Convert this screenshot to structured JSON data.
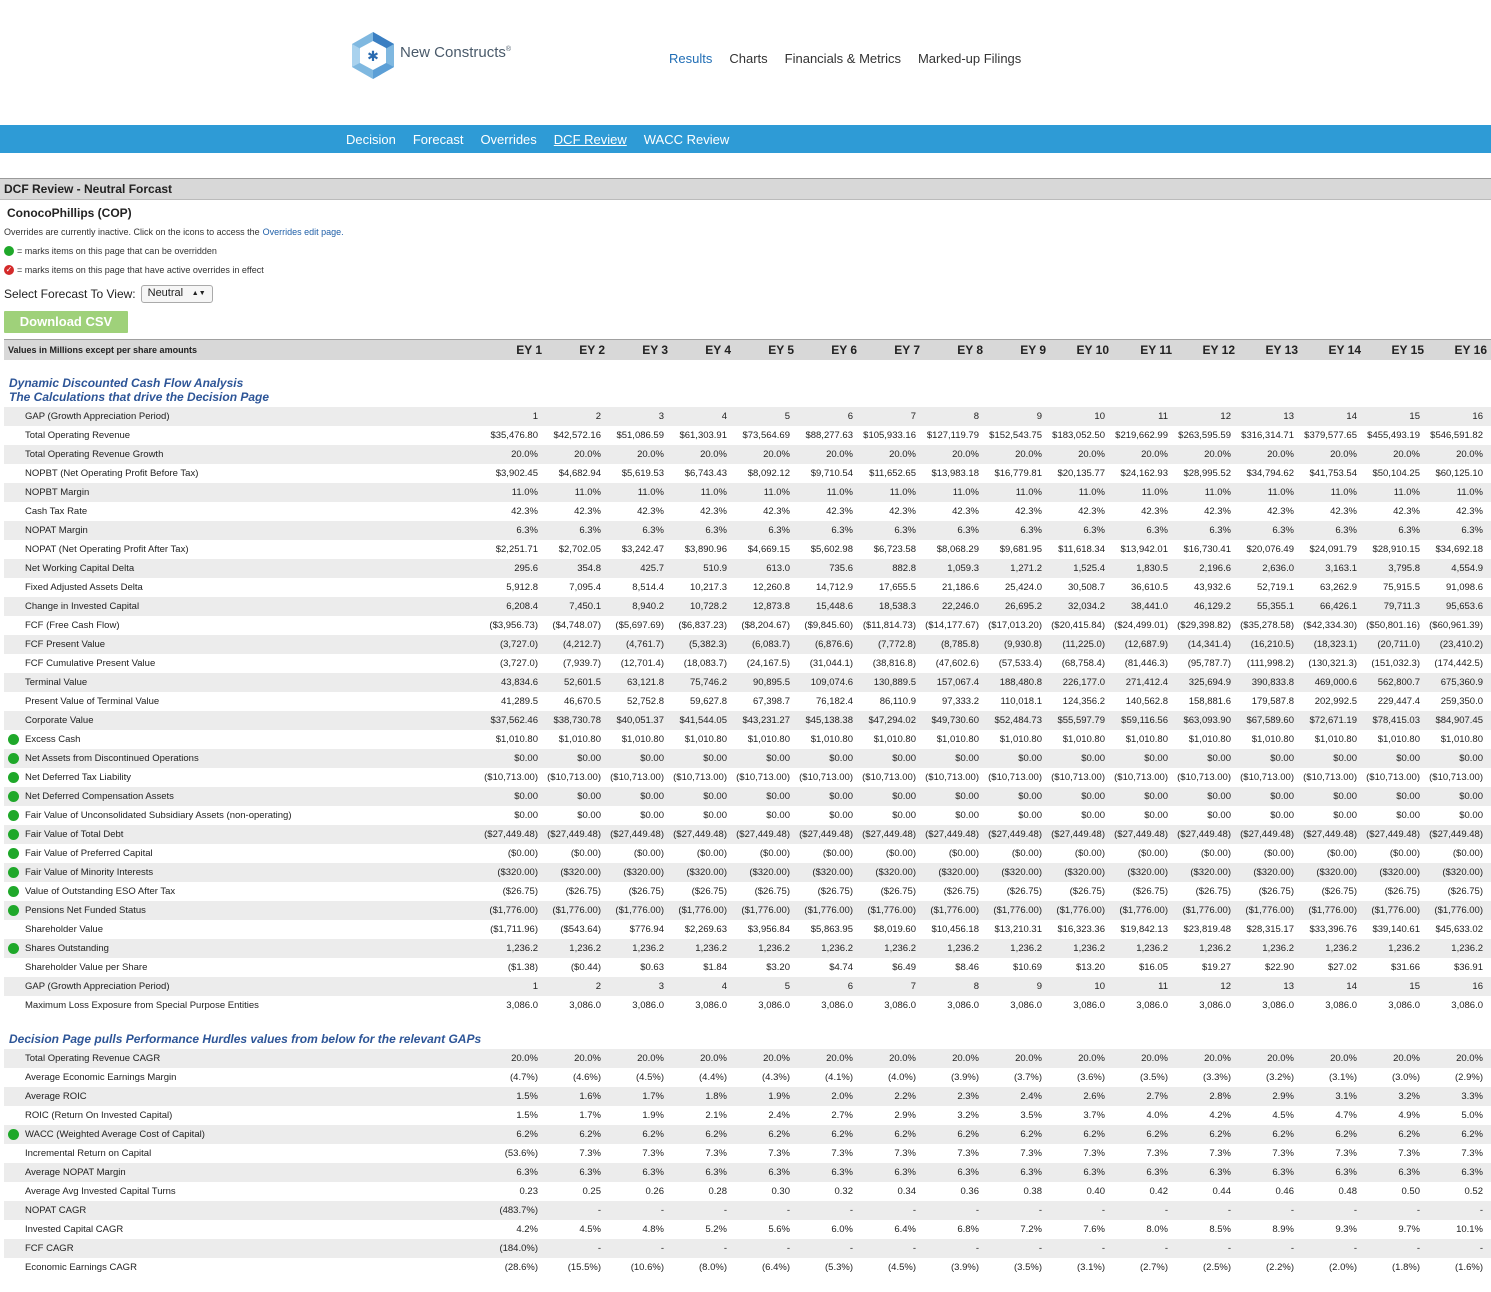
{
  "brand": {
    "name": "New Constructs",
    "mark": "®"
  },
  "top_nav": [
    {
      "label": "Results",
      "active": true
    },
    {
      "label": "Charts",
      "active": false
    },
    {
      "label": "Financials & Metrics",
      "active": false
    },
    {
      "label": "Marked-up Filings",
      "active": false
    }
  ],
  "sub_nav": [
    {
      "label": "Decision",
      "active": false
    },
    {
      "label": "Forecast",
      "active": false
    },
    {
      "label": "Overrides",
      "active": false
    },
    {
      "label": "DCF Review",
      "active": true
    },
    {
      "label": "WACC Review",
      "active": false
    }
  ],
  "section_title": "DCF Review - Neutral Forcast",
  "company": "ConocoPhillips (COP)",
  "notes": {
    "inactive": "Overrides are currently inactive. Click on the icons to access the",
    "inactive_link": "Overrides edit page.",
    "can_override": "= marks items on this page that can be overridden",
    "active_override": "= marks items on this page that have active overrides in effect"
  },
  "forecast_select": {
    "label": "Select Forecast To View:",
    "value": "Neutral"
  },
  "download_label": "Download CSV",
  "table_header": {
    "label": "Values in Millions except per share amounts",
    "columns": [
      "EY 1",
      "EY 2",
      "EY 3",
      "EY 4",
      "EY 5",
      "EY 6",
      "EY 7",
      "EY 8",
      "EY 9",
      "EY 10",
      "EY 11",
      "EY 12",
      "EY 13",
      "EY 14",
      "EY 15",
      "EY 16"
    ]
  },
  "heading1": [
    "Dynamic Discounted Cash Flow Analysis",
    "The Calculations that drive the Decision Page"
  ],
  "heading2": "Decision Page pulls Performance Hurdles values from below for the relevant GAPs",
  "dcf_rows": [
    {
      "name": "GAP (Growth Appreciation Period)",
      "dot": false,
      "values": [
        "1",
        "2",
        "3",
        "4",
        "5",
        "6",
        "7",
        "8",
        "9",
        "10",
        "11",
        "12",
        "13",
        "14",
        "15",
        "16"
      ]
    },
    {
      "name": "Total Operating Revenue",
      "dot": false,
      "values": [
        "$35,476.80",
        "$42,572.16",
        "$51,086.59",
        "$61,303.91",
        "$73,564.69",
        "$88,277.63",
        "$105,933.16",
        "$127,119.79",
        "$152,543.75",
        "$183,052.50",
        "$219,662.99",
        "$263,595.59",
        "$316,314.71",
        "$379,577.65",
        "$455,493.19",
        "$546,591.82"
      ]
    },
    {
      "name": "Total Operating Revenue Growth",
      "dot": false,
      "values": [
        "20.0%",
        "20.0%",
        "20.0%",
        "20.0%",
        "20.0%",
        "20.0%",
        "20.0%",
        "20.0%",
        "20.0%",
        "20.0%",
        "20.0%",
        "20.0%",
        "20.0%",
        "20.0%",
        "20.0%",
        "20.0%"
      ]
    },
    {
      "name": "NOPBT (Net Operating Profit Before Tax)",
      "dot": false,
      "values": [
        "$3,902.45",
        "$4,682.94",
        "$5,619.53",
        "$6,743.43",
        "$8,092.12",
        "$9,710.54",
        "$11,652.65",
        "$13,983.18",
        "$16,779.81",
        "$20,135.77",
        "$24,162.93",
        "$28,995.52",
        "$34,794.62",
        "$41,753.54",
        "$50,104.25",
        "$60,125.10"
      ]
    },
    {
      "name": "NOPBT Margin",
      "dot": false,
      "values": [
        "11.0%",
        "11.0%",
        "11.0%",
        "11.0%",
        "11.0%",
        "11.0%",
        "11.0%",
        "11.0%",
        "11.0%",
        "11.0%",
        "11.0%",
        "11.0%",
        "11.0%",
        "11.0%",
        "11.0%",
        "11.0%"
      ]
    },
    {
      "name": "Cash Tax Rate",
      "dot": false,
      "values": [
        "42.3%",
        "42.3%",
        "42.3%",
        "42.3%",
        "42.3%",
        "42.3%",
        "42.3%",
        "42.3%",
        "42.3%",
        "42.3%",
        "42.3%",
        "42.3%",
        "42.3%",
        "42.3%",
        "42.3%",
        "42.3%"
      ]
    },
    {
      "name": "NOPAT Margin",
      "dot": false,
      "values": [
        "6.3%",
        "6.3%",
        "6.3%",
        "6.3%",
        "6.3%",
        "6.3%",
        "6.3%",
        "6.3%",
        "6.3%",
        "6.3%",
        "6.3%",
        "6.3%",
        "6.3%",
        "6.3%",
        "6.3%",
        "6.3%"
      ]
    },
    {
      "name": "NOPAT (Net Operating Profit After Tax)",
      "dot": false,
      "values": [
        "$2,251.71",
        "$2,702.05",
        "$3,242.47",
        "$3,890.96",
        "$4,669.15",
        "$5,602.98",
        "$6,723.58",
        "$8,068.29",
        "$9,681.95",
        "$11,618.34",
        "$13,942.01",
        "$16,730.41",
        "$20,076.49",
        "$24,091.79",
        "$28,910.15",
        "$34,692.18"
      ]
    },
    {
      "name": "Net Working Capital Delta",
      "dot": false,
      "values": [
        "295.6",
        "354.8",
        "425.7",
        "510.9",
        "613.0",
        "735.6",
        "882.8",
        "1,059.3",
        "1,271.2",
        "1,525.4",
        "1,830.5",
        "2,196.6",
        "2,636.0",
        "3,163.1",
        "3,795.8",
        "4,554.9"
      ]
    },
    {
      "name": "Fixed Adjusted Assets Delta",
      "dot": false,
      "values": [
        "5,912.8",
        "7,095.4",
        "8,514.4",
        "10,217.3",
        "12,260.8",
        "14,712.9",
        "17,655.5",
        "21,186.6",
        "25,424.0",
        "30,508.7",
        "36,610.5",
        "43,932.6",
        "52,719.1",
        "63,262.9",
        "75,915.5",
        "91,098.6"
      ]
    },
    {
      "name": "Change in Invested Capital",
      "dot": false,
      "values": [
        "6,208.4",
        "7,450.1",
        "8,940.2",
        "10,728.2",
        "12,873.8",
        "15,448.6",
        "18,538.3",
        "22,246.0",
        "26,695.2",
        "32,034.2",
        "38,441.0",
        "46,129.2",
        "55,355.1",
        "66,426.1",
        "79,711.3",
        "95,653.6"
      ]
    },
    {
      "name": "FCF (Free Cash Flow)",
      "dot": false,
      "values": [
        "($3,956.73)",
        "($4,748.07)",
        "($5,697.69)",
        "($6,837.23)",
        "($8,204.67)",
        "($9,845.60)",
        "($11,814.73)",
        "($14,177.67)",
        "($17,013.20)",
        "($20,415.84)",
        "($24,499.01)",
        "($29,398.82)",
        "($35,278.58)",
        "($42,334.30)",
        "($50,801.16)",
        "($60,961.39)"
      ]
    },
    {
      "name": "FCF Present Value",
      "dot": false,
      "values": [
        "(3,727.0)",
        "(4,212.7)",
        "(4,761.7)",
        "(5,382.3)",
        "(6,083.7)",
        "(6,876.6)",
        "(7,772.8)",
        "(8,785.8)",
        "(9,930.8)",
        "(11,225.0)",
        "(12,687.9)",
        "(14,341.4)",
        "(16,210.5)",
        "(18,323.1)",
        "(20,711.0)",
        "(23,410.2)"
      ]
    },
    {
      "name": "FCF Cumulative Present Value",
      "dot": false,
      "values": [
        "(3,727.0)",
        "(7,939.7)",
        "(12,701.4)",
        "(18,083.7)",
        "(24,167.5)",
        "(31,044.1)",
        "(38,816.8)",
        "(47,602.6)",
        "(57,533.4)",
        "(68,758.4)",
        "(81,446.3)",
        "(95,787.7)",
        "(111,998.2)",
        "(130,321.3)",
        "(151,032.3)",
        "(174,442.5)"
      ]
    },
    {
      "name": "Terminal Value",
      "dot": false,
      "values": [
        "43,834.6",
        "52,601.5",
        "63,121.8",
        "75,746.2",
        "90,895.5",
        "109,074.6",
        "130,889.5",
        "157,067.4",
        "188,480.8",
        "226,177.0",
        "271,412.4",
        "325,694.9",
        "390,833.8",
        "469,000.6",
        "562,800.7",
        "675,360.9"
      ]
    },
    {
      "name": "Present Value of Terminal Value",
      "dot": false,
      "values": [
        "41,289.5",
        "46,670.5",
        "52,752.8",
        "59,627.8",
        "67,398.7",
        "76,182.4",
        "86,110.9",
        "97,333.2",
        "110,018.1",
        "124,356.2",
        "140,562.8",
        "158,881.6",
        "179,587.8",
        "202,992.5",
        "229,447.4",
        "259,350.0"
      ]
    },
    {
      "name": "Corporate Value",
      "dot": false,
      "values": [
        "$37,562.46",
        "$38,730.78",
        "$40,051.37",
        "$41,544.05",
        "$43,231.27",
        "$45,138.38",
        "$47,294.02",
        "$49,730.60",
        "$52,484.73",
        "$55,597.79",
        "$59,116.56",
        "$63,093.90",
        "$67,589.60",
        "$72,671.19",
        "$78,415.03",
        "$84,907.45"
      ]
    },
    {
      "name": "Excess Cash",
      "dot": true,
      "values": [
        "$1,010.80",
        "$1,010.80",
        "$1,010.80",
        "$1,010.80",
        "$1,010.80",
        "$1,010.80",
        "$1,010.80",
        "$1,010.80",
        "$1,010.80",
        "$1,010.80",
        "$1,010.80",
        "$1,010.80",
        "$1,010.80",
        "$1,010.80",
        "$1,010.80",
        "$1,010.80"
      ]
    },
    {
      "name": "Net Assets from Discontinued Operations",
      "dot": true,
      "values": [
        "$0.00",
        "$0.00",
        "$0.00",
        "$0.00",
        "$0.00",
        "$0.00",
        "$0.00",
        "$0.00",
        "$0.00",
        "$0.00",
        "$0.00",
        "$0.00",
        "$0.00",
        "$0.00",
        "$0.00",
        "$0.00"
      ]
    },
    {
      "name": "Net Deferred Tax Liability",
      "dot": true,
      "values": [
        "($10,713.00)",
        "($10,713.00)",
        "($10,713.00)",
        "($10,713.00)",
        "($10,713.00)",
        "($10,713.00)",
        "($10,713.00)",
        "($10,713.00)",
        "($10,713.00)",
        "($10,713.00)",
        "($10,713.00)",
        "($10,713.00)",
        "($10,713.00)",
        "($10,713.00)",
        "($10,713.00)",
        "($10,713.00)"
      ]
    },
    {
      "name": "Net Deferred Compensation Assets",
      "dot": true,
      "values": [
        "$0.00",
        "$0.00",
        "$0.00",
        "$0.00",
        "$0.00",
        "$0.00",
        "$0.00",
        "$0.00",
        "$0.00",
        "$0.00",
        "$0.00",
        "$0.00",
        "$0.00",
        "$0.00",
        "$0.00",
        "$0.00"
      ]
    },
    {
      "name": "Fair Value of Unconsolidated Subsidiary Assets (non-operating)",
      "dot": true,
      "values": [
        "$0.00",
        "$0.00",
        "$0.00",
        "$0.00",
        "$0.00",
        "$0.00",
        "$0.00",
        "$0.00",
        "$0.00",
        "$0.00",
        "$0.00",
        "$0.00",
        "$0.00",
        "$0.00",
        "$0.00",
        "$0.00"
      ]
    },
    {
      "name": "Fair Value of Total Debt",
      "dot": true,
      "values": [
        "($27,449.48)",
        "($27,449.48)",
        "($27,449.48)",
        "($27,449.48)",
        "($27,449.48)",
        "($27,449.48)",
        "($27,449.48)",
        "($27,449.48)",
        "($27,449.48)",
        "($27,449.48)",
        "($27,449.48)",
        "($27,449.48)",
        "($27,449.48)",
        "($27,449.48)",
        "($27,449.48)",
        "($27,449.48)"
      ]
    },
    {
      "name": "Fair Value of Preferred Capital",
      "dot": true,
      "values": [
        "($0.00)",
        "($0.00)",
        "($0.00)",
        "($0.00)",
        "($0.00)",
        "($0.00)",
        "($0.00)",
        "($0.00)",
        "($0.00)",
        "($0.00)",
        "($0.00)",
        "($0.00)",
        "($0.00)",
        "($0.00)",
        "($0.00)",
        "($0.00)"
      ]
    },
    {
      "name": "Fair Value of Minority Interests",
      "dot": true,
      "values": [
        "($320.00)",
        "($320.00)",
        "($320.00)",
        "($320.00)",
        "($320.00)",
        "($320.00)",
        "($320.00)",
        "($320.00)",
        "($320.00)",
        "($320.00)",
        "($320.00)",
        "($320.00)",
        "($320.00)",
        "($320.00)",
        "($320.00)",
        "($320.00)"
      ]
    },
    {
      "name": "Value of Outstanding ESO After Tax",
      "dot": true,
      "values": [
        "($26.75)",
        "($26.75)",
        "($26.75)",
        "($26.75)",
        "($26.75)",
        "($26.75)",
        "($26.75)",
        "($26.75)",
        "($26.75)",
        "($26.75)",
        "($26.75)",
        "($26.75)",
        "($26.75)",
        "($26.75)",
        "($26.75)",
        "($26.75)"
      ]
    },
    {
      "name": "Pensions Net Funded Status",
      "dot": true,
      "values": [
        "($1,776.00)",
        "($1,776.00)",
        "($1,776.00)",
        "($1,776.00)",
        "($1,776.00)",
        "($1,776.00)",
        "($1,776.00)",
        "($1,776.00)",
        "($1,776.00)",
        "($1,776.00)",
        "($1,776.00)",
        "($1,776.00)",
        "($1,776.00)",
        "($1,776.00)",
        "($1,776.00)",
        "($1,776.00)"
      ]
    },
    {
      "name": "Shareholder Value",
      "dot": false,
      "values": [
        "($1,711.96)",
        "($543.64)",
        "$776.94",
        "$2,269.63",
        "$3,956.84",
        "$5,863.95",
        "$8,019.60",
        "$10,456.18",
        "$13,210.31",
        "$16,323.36",
        "$19,842.13",
        "$23,819.48",
        "$28,315.17",
        "$33,396.76",
        "$39,140.61",
        "$45,633.02"
      ]
    },
    {
      "name": "Shares Outstanding",
      "dot": true,
      "values": [
        "1,236.2",
        "1,236.2",
        "1,236.2",
        "1,236.2",
        "1,236.2",
        "1,236.2",
        "1,236.2",
        "1,236.2",
        "1,236.2",
        "1,236.2",
        "1,236.2",
        "1,236.2",
        "1,236.2",
        "1,236.2",
        "1,236.2",
        "1,236.2"
      ]
    },
    {
      "name": "Shareholder Value per Share",
      "dot": false,
      "values": [
        "($1.38)",
        "($0.44)",
        "$0.63",
        "$1.84",
        "$3.20",
        "$4.74",
        "$6.49",
        "$8.46",
        "$10.69",
        "$13.20",
        "$16.05",
        "$19.27",
        "$22.90",
        "$27.02",
        "$31.66",
        "$36.91"
      ]
    },
    {
      "name": "GAP (Growth Appreciation Period)",
      "dot": false,
      "values": [
        "1",
        "2",
        "3",
        "4",
        "5",
        "6",
        "7",
        "8",
        "9",
        "10",
        "11",
        "12",
        "13",
        "14",
        "15",
        "16"
      ]
    },
    {
      "name": "Maximum Loss Exposure from Special Purpose Entities",
      "dot": false,
      "values": [
        "3,086.0",
        "3,086.0",
        "3,086.0",
        "3,086.0",
        "3,086.0",
        "3,086.0",
        "3,086.0",
        "3,086.0",
        "3,086.0",
        "3,086.0",
        "3,086.0",
        "3,086.0",
        "3,086.0",
        "3,086.0",
        "3,086.0",
        "3,086.0"
      ]
    }
  ],
  "hurdle_rows": [
    {
      "name": "Total Operating Revenue CAGR",
      "dot": false,
      "values": [
        "20.0%",
        "20.0%",
        "20.0%",
        "20.0%",
        "20.0%",
        "20.0%",
        "20.0%",
        "20.0%",
        "20.0%",
        "20.0%",
        "20.0%",
        "20.0%",
        "20.0%",
        "20.0%",
        "20.0%",
        "20.0%"
      ]
    },
    {
      "name": "Average Economic Earnings Margin",
      "dot": false,
      "values": [
        "(4.7%)",
        "(4.6%)",
        "(4.5%)",
        "(4.4%)",
        "(4.3%)",
        "(4.1%)",
        "(4.0%)",
        "(3.9%)",
        "(3.7%)",
        "(3.6%)",
        "(3.5%)",
        "(3.3%)",
        "(3.2%)",
        "(3.1%)",
        "(3.0%)",
        "(2.9%)"
      ]
    },
    {
      "name": "Average ROIC",
      "dot": false,
      "values": [
        "1.5%",
        "1.6%",
        "1.7%",
        "1.8%",
        "1.9%",
        "2.0%",
        "2.2%",
        "2.3%",
        "2.4%",
        "2.6%",
        "2.7%",
        "2.8%",
        "2.9%",
        "3.1%",
        "3.2%",
        "3.3%"
      ]
    },
    {
      "name": "ROIC (Return On Invested Capital)",
      "dot": false,
      "values": [
        "1.5%",
        "1.7%",
        "1.9%",
        "2.1%",
        "2.4%",
        "2.7%",
        "2.9%",
        "3.2%",
        "3.5%",
        "3.7%",
        "4.0%",
        "4.2%",
        "4.5%",
        "4.7%",
        "4.9%",
        "5.0%"
      ]
    },
    {
      "name": "WACC (Weighted Average Cost of Capital)",
      "dot": true,
      "values": [
        "6.2%",
        "6.2%",
        "6.2%",
        "6.2%",
        "6.2%",
        "6.2%",
        "6.2%",
        "6.2%",
        "6.2%",
        "6.2%",
        "6.2%",
        "6.2%",
        "6.2%",
        "6.2%",
        "6.2%",
        "6.2%"
      ]
    },
    {
      "name": "Incremental Return on Capital",
      "dot": false,
      "values": [
        "(53.6%)",
        "7.3%",
        "7.3%",
        "7.3%",
        "7.3%",
        "7.3%",
        "7.3%",
        "7.3%",
        "7.3%",
        "7.3%",
        "7.3%",
        "7.3%",
        "7.3%",
        "7.3%",
        "7.3%",
        "7.3%"
      ]
    },
    {
      "name": "Average NOPAT Margin",
      "dot": false,
      "values": [
        "6.3%",
        "6.3%",
        "6.3%",
        "6.3%",
        "6.3%",
        "6.3%",
        "6.3%",
        "6.3%",
        "6.3%",
        "6.3%",
        "6.3%",
        "6.3%",
        "6.3%",
        "6.3%",
        "6.3%",
        "6.3%"
      ]
    },
    {
      "name": "Average Avg Invested Capital Turns",
      "dot": false,
      "values": [
        "0.23",
        "0.25",
        "0.26",
        "0.28",
        "0.30",
        "0.32",
        "0.34",
        "0.36",
        "0.38",
        "0.40",
        "0.42",
        "0.44",
        "0.46",
        "0.48",
        "0.50",
        "0.52"
      ]
    },
    {
      "name": "NOPAT CAGR",
      "dot": false,
      "values": [
        "(483.7%)",
        "-",
        "-",
        "-",
        "-",
        "-",
        "-",
        "-",
        "-",
        "-",
        "-",
        "-",
        "-",
        "-",
        "-",
        "-"
      ]
    },
    {
      "name": "Invested Capital CAGR",
      "dot": false,
      "values": [
        "4.2%",
        "4.5%",
        "4.8%",
        "5.2%",
        "5.6%",
        "6.0%",
        "6.4%",
        "6.8%",
        "7.2%",
        "7.6%",
        "8.0%",
        "8.5%",
        "8.9%",
        "9.3%",
        "9.7%",
        "10.1%"
      ]
    },
    {
      "name": "FCF CAGR",
      "dot": false,
      "values": [
        "(184.0%)",
        "-",
        "-",
        "-",
        "-",
        "-",
        "-",
        "-",
        "-",
        "-",
        "-",
        "-",
        "-",
        "-",
        "-",
        "-"
      ]
    },
    {
      "name": "Economic Earnings CAGR",
      "dot": false,
      "values": [
        "(28.6%)",
        "(15.5%)",
        "(10.6%)",
        "(8.0%)",
        "(6.4%)",
        "(5.3%)",
        "(4.5%)",
        "(3.9%)",
        "(3.5%)",
        "(3.1%)",
        "(2.7%)",
        "(2.5%)",
        "(2.2%)",
        "(2.0%)",
        "(1.8%)",
        "(1.6%)"
      ]
    }
  ]
}
